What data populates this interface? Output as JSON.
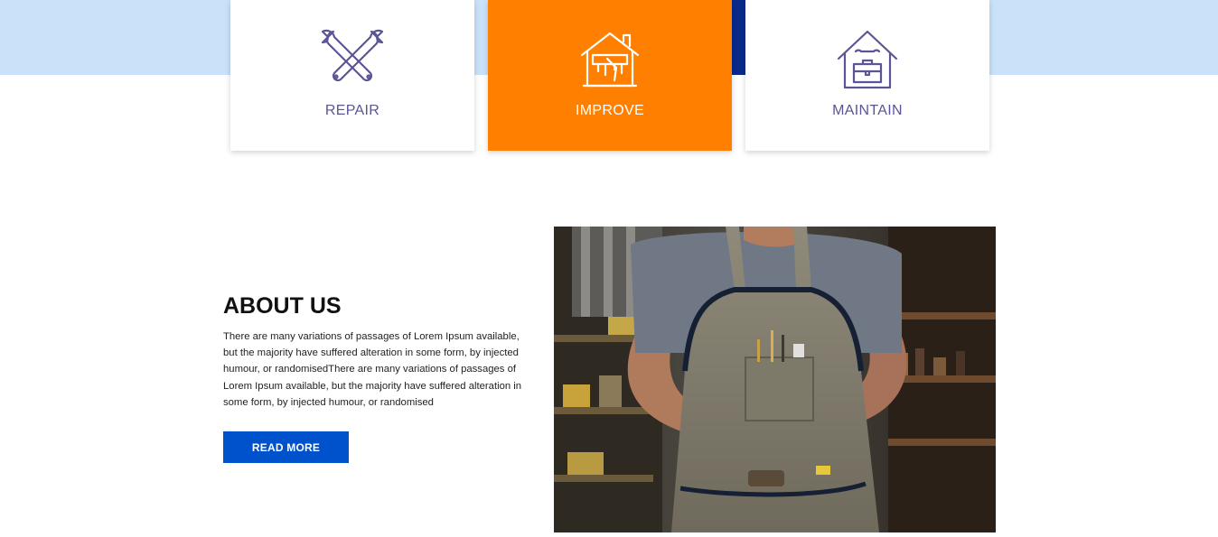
{
  "services": {
    "cards": [
      {
        "label": "REPAIR",
        "icon": "tools-icon"
      },
      {
        "label": "IMPROVE",
        "icon": "house-paint-icon"
      },
      {
        "label": "MAINTAIN",
        "icon": "house-toolbox-icon"
      }
    ]
  },
  "about": {
    "title": "ABOUT US",
    "body": "There are many variations of passages of Lorem Ipsum available, but the majority have suffered alteration in some form, by injected humour, or randomisedThere are many variations of passages of Lorem Ipsum available, but the majority have suffered alteration in some form, by injected humour, or randomised",
    "button_label": "READ MORE",
    "image": "craftsman-apron-photo"
  },
  "colors": {
    "band": "#c9e2fa",
    "accent_orange": "#ff8000",
    "button_blue": "#0052cc",
    "icon_purple": "#5a5595"
  }
}
